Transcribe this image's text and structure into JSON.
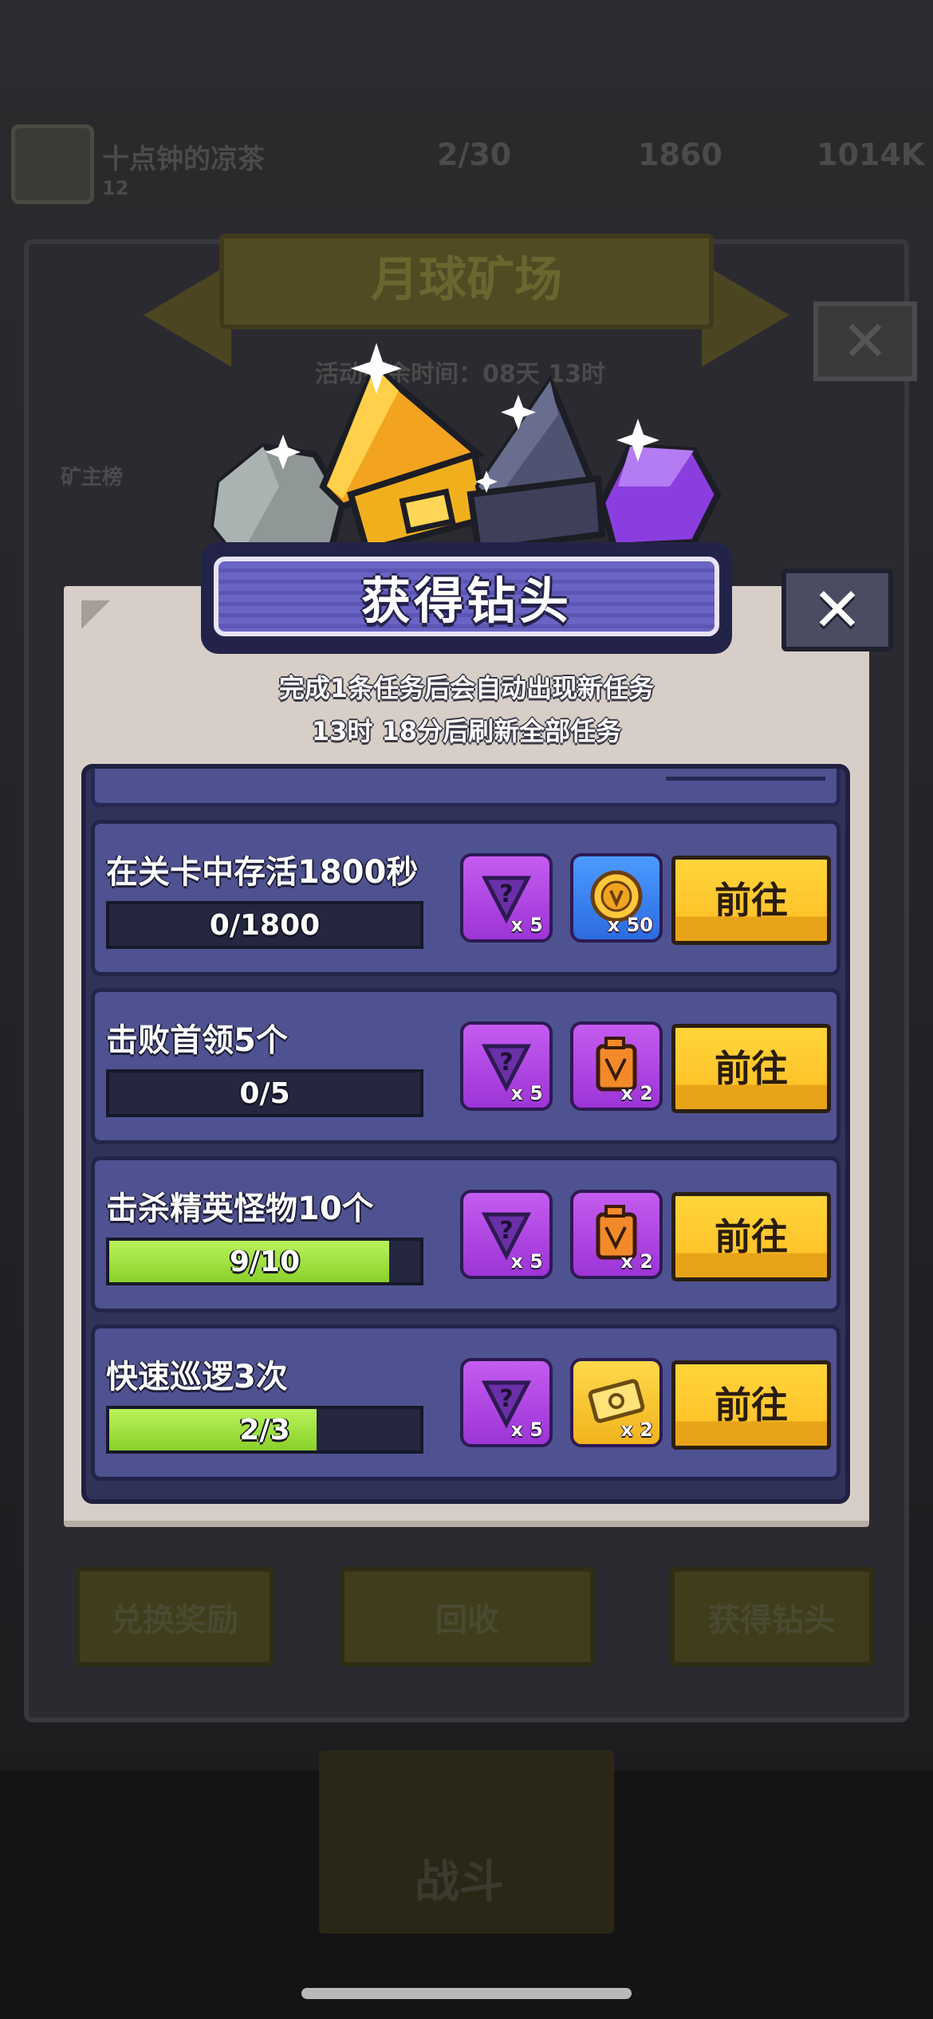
{
  "background": {
    "player_name": "十点钟的凉茶",
    "player_level": "12",
    "stat_1": "2/30",
    "stat_2": "1860",
    "stat_3": "1014K",
    "banner_title": "月球矿场",
    "event_time": "活动剩余时间：08天 13时",
    "leaderboard_label": "矿主榜",
    "bottom_buttons": [
      "兑换奖励",
      "回收",
      "获得钻头"
    ],
    "nav_center_label": "战斗"
  },
  "modal": {
    "title": "获得钻头",
    "close_symbol": "✕",
    "info_line_1": "完成1条任务后会自动出现新任务",
    "info_line_2": "13时 18分后刷新全部任务",
    "tasks": [
      {
        "title": "在关卡中存活1800秒",
        "progress_text": "0/1800",
        "progress_value": 0,
        "progress_max": 1800,
        "rewards": [
          {
            "icon": "mystery-drill-icon",
            "qty": "x 5",
            "color": "purple"
          },
          {
            "icon": "gold-coin-icon",
            "qty": "x 50",
            "color": "blue"
          }
        ],
        "button": "前往"
      },
      {
        "title": "击败首领5个",
        "progress_text": "0/5",
        "progress_value": 0,
        "progress_max": 5,
        "rewards": [
          {
            "icon": "mystery-drill-icon",
            "qty": "x 5",
            "color": "purple"
          },
          {
            "icon": "fuel-can-icon",
            "qty": "x 2",
            "color": "purple"
          }
        ],
        "button": "前往"
      },
      {
        "title": "击杀精英怪物10个",
        "progress_text": "9/10",
        "progress_value": 9,
        "progress_max": 10,
        "rewards": [
          {
            "icon": "mystery-drill-icon",
            "qty": "x 5",
            "color": "purple"
          },
          {
            "icon": "fuel-can-icon",
            "qty": "x 2",
            "color": "purple"
          }
        ],
        "button": "前往"
      },
      {
        "title": "快速巡逻3次",
        "progress_text": "2/3",
        "progress_value": 2,
        "progress_max": 3,
        "rewards": [
          {
            "icon": "mystery-drill-icon",
            "qty": "x 5",
            "color": "purple"
          },
          {
            "icon": "ticket-icon",
            "qty": "x 2",
            "color": "gold"
          }
        ],
        "button": "前往"
      }
    ]
  },
  "colors": {
    "progress_fill": "#a6e544",
    "go_button": "#ffc42a",
    "task_bg": "#4f5290",
    "modal_bg": "#d7cfc7"
  }
}
